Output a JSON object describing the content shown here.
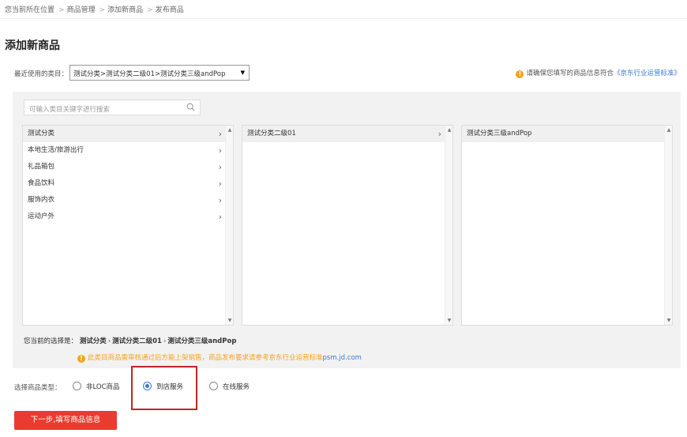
{
  "breadcrumb": {
    "items": [
      "您当前所在位置",
      "商品管理",
      "添加新商品",
      "发布商品"
    ],
    "separator": ">"
  },
  "page": {
    "title": "添加新商品"
  },
  "recent": {
    "label": "最近使用的类目：",
    "selected": "测试分类>测试分类二级01>测试分类三级andPop"
  },
  "notice": {
    "text": "请确保您填写的商品信息符合",
    "link": "《京东行业运营标准》"
  },
  "search": {
    "placeholder": "可输入类目关键字进行搜索"
  },
  "columns": {
    "level1": [
      "测试分类",
      "本地生活/旅游出行",
      "礼品箱包",
      "食品饮料",
      "服饰内衣",
      "运动户外"
    ],
    "level2": [
      "测试分类二级01"
    ],
    "level3": [
      "测试分类三级andPop"
    ]
  },
  "selection": {
    "label": "您当前的选择是：",
    "path": [
      "测试分类",
      "测试分类二级01",
      "测试分类三级andPop"
    ]
  },
  "warning": {
    "text": "此类目商品需审核通过后方能上架销售，商品发布要求请参考京东行业运营标准",
    "link": "psm.jd.com"
  },
  "productType": {
    "label": "选择商品类型：",
    "options": [
      "非LOC商品",
      "到店服务",
      "在线服务"
    ],
    "selected": "到店服务"
  },
  "actions": {
    "next": "下一步,填写商品信息"
  },
  "colors": {
    "accent": "#e93b2f",
    "link": "#3a7ad8",
    "warning": "#f7a21c",
    "highlight": "#c0262c"
  }
}
